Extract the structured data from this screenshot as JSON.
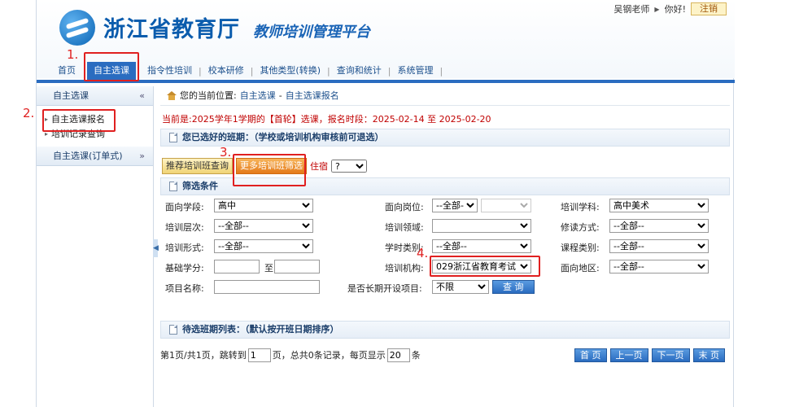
{
  "header": {
    "brand": "浙江省教育厅",
    "subbrand": "教师培训管理平台",
    "user": "吴钢老师",
    "greeting": "你好!",
    "logout": "注销"
  },
  "nav": {
    "items": [
      "首页",
      "自主选课",
      "指令性培训",
      "校本研修",
      "其他类型(转换)",
      "查询和统计",
      "系统管理"
    ]
  },
  "sidebar": {
    "group1": "自主选课",
    "toggle1": "«",
    "links": [
      "自主选课报名",
      "培训记录查询"
    ],
    "group2": "自主选课(订单式)",
    "toggle2": "»"
  },
  "breadcrumb": {
    "prefix": "您的当前位置:",
    "level1": "自主选课",
    "sep": "-",
    "level2": "自主选课报名"
  },
  "notice": "当前是:2025学年1学期的【首轮】选课，报名时段：2025-02-14 至 2025-02-20",
  "selected_section": "您已选好的班期：（学校或培训机构审核前可退选）",
  "tabs": {
    "recommend": "推荐培训班查询",
    "more": "更多培训班筛选",
    "lodging_label": "住宿",
    "lodging_value": "?"
  },
  "filter": {
    "title": "筛选条件",
    "stage_label": "面向学段:",
    "stage_value": "高中",
    "post_label": "面向岗位:",
    "post_value": "--全部-",
    "subject_label": "培训学科:",
    "subject_value": "高中美术",
    "level_label": "培训层次:",
    "level_value": "--全部--",
    "field_label": "培训领域:",
    "field_value": "",
    "study_label": "修读方式:",
    "study_value": "--全部--",
    "form_label": "培训形式:",
    "form_value": "--全部--",
    "hours_label": "学时类别:",
    "hours_value": "--全部--",
    "course_label": "课程类别:",
    "course_value": "--全部--",
    "credit_label": "基础学分:",
    "credit_to": "至",
    "org_label": "培训机构:",
    "org_value": "029浙江省教育考试",
    "region_label": "面向地区:",
    "region_value": "--全部--",
    "name_label": "项目名称:",
    "longterm_label": "是否长期开设项目:",
    "longterm_value": "不限",
    "query": "查 询"
  },
  "pending_section": "待选班期列表：（默认按开班日期排序）",
  "pager": {
    "info": "第1页/共1页，跳转到",
    "page_value": "1",
    "mid": "页，总共0条记录，每页显示",
    "size_value": "20",
    "unit": "条",
    "first": "首 页",
    "prev": "上一页",
    "next": "下一页",
    "last": "末 页"
  },
  "annotations": [
    "1.",
    "2.",
    "3.",
    "4."
  ],
  "colors": {
    "brand": "#0b5cad",
    "nav_active": "#2a6cc0",
    "annotation": "#e02020",
    "notice": "#c00000"
  }
}
